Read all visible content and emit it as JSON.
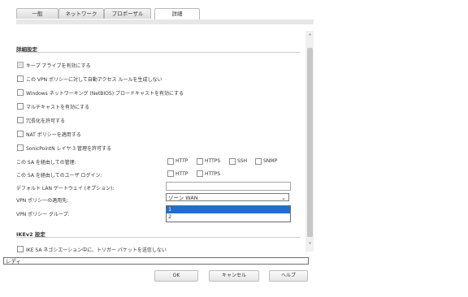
{
  "tabs": [
    {
      "label": "一般"
    },
    {
      "label": "ネットワーク"
    },
    {
      "label": "プロポーザル"
    },
    {
      "label": "詳細"
    }
  ],
  "section_advanced": {
    "title": "詳細設定",
    "checkboxes": [
      {
        "label": "キープ アライブを有効にする"
      },
      {
        "label": "この VPN ポリシーに対して自動アクセス ルールを生成しない"
      },
      {
        "label": "Windows ネットワーキング (NetBIOS) ブロードキャストを有効にする"
      },
      {
        "label": "マルチキャストを有効にする"
      },
      {
        "label": "冗長化を許可する"
      },
      {
        "label": "NAT ポリシーを適用する"
      },
      {
        "label": "SonicPointN レイヤ 3 管理を許可する"
      }
    ],
    "mgmt_label": "この SA を経由しての管理:",
    "mgmt_options": [
      "HTTP",
      "HTTPS",
      "SSH",
      "SNMP"
    ],
    "login_label": "この SA を経由してのユーザ ログイン:",
    "login_options": [
      "HTTP",
      "HTTPS"
    ],
    "gateway_label": "デフォルト LAN ゲートウェイ (オプション):",
    "gateway_value": "",
    "bind_label": "VPN ポリシーの適用先:",
    "bind_value": "ゾーン WAN",
    "group_label": "VPN ポリシー グループ:",
    "group_options": [
      "1",
      "2"
    ],
    "group_selected": "1"
  },
  "section_ikev2": {
    "title": "IKEv2 設定",
    "checkbox": "IKE SA ネゴシエーション中に、トリガー パケットを送信しない"
  },
  "status": {
    "text": "レディ"
  },
  "buttons": {
    "ok": "OK",
    "cancel": "キャンセル",
    "help": "ヘルプ"
  }
}
